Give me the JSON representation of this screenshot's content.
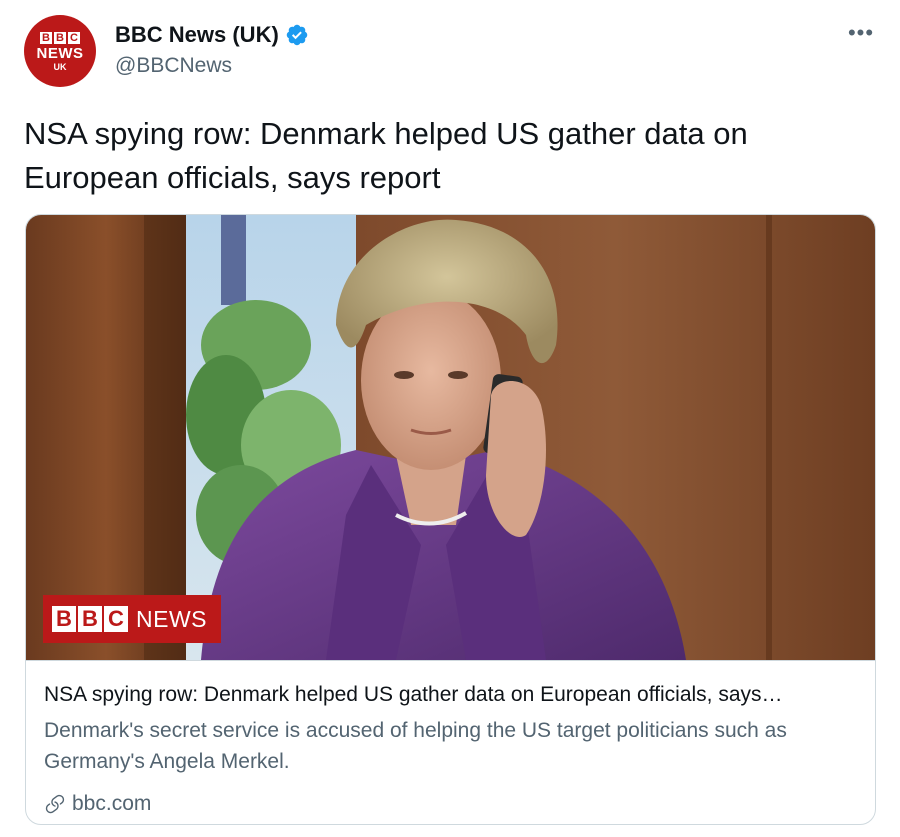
{
  "account": {
    "display_name": "BBC News (UK)",
    "handle": "@BBCNews",
    "verified_icon": "verified-badge-icon",
    "avatar": {
      "letters": [
        "B",
        "B",
        "C"
      ],
      "word": "NEWS",
      "region": "UK"
    }
  },
  "menu": {
    "more_label": "•••"
  },
  "tweet": {
    "text": "NSA spying row: Denmark helped US gather data on European officials, says report"
  },
  "card": {
    "image_logo": {
      "letters": [
        "B",
        "B",
        "C"
      ],
      "word": "NEWS"
    },
    "title": "NSA spying row: Denmark helped US gather data on European officials, says…",
    "description": "Denmark's secret service is accused of helping the US target politicians such as Germany's Angela Merkel.",
    "domain": "bbc.com",
    "link_icon": "link-icon"
  },
  "colors": {
    "bbc_red": "#bb1919",
    "verified_blue": "#1d9bf0",
    "text_primary": "#0f1419",
    "text_secondary": "#536471",
    "border": "#cfd9de"
  }
}
